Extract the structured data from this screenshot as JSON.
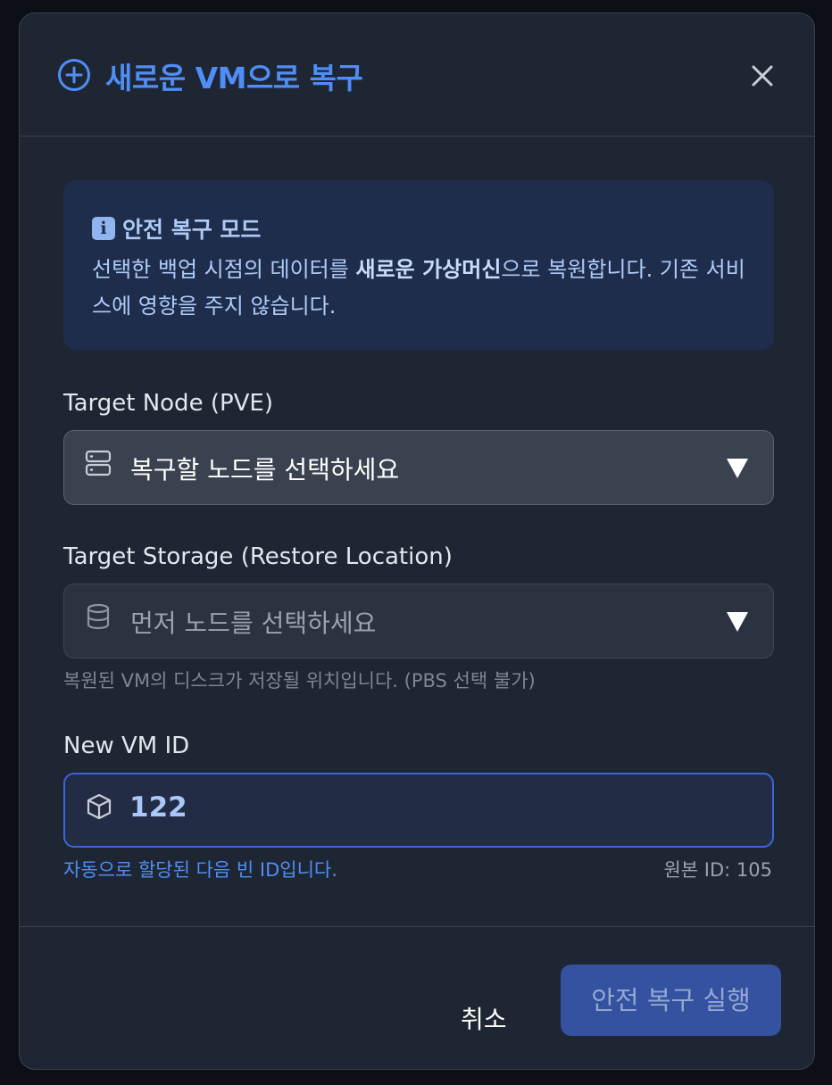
{
  "dialog": {
    "title": "새로운 VM으로 복구",
    "close_icon": "close-icon",
    "title_icon": "plus-circle-icon",
    "accent_color": "#4f8ef7"
  },
  "info": {
    "icon": "info-icon",
    "title": "안전 복구 모드",
    "body_before": "선택한 백업 시점의 데이터를 ",
    "body_bold": "새로운 가상머신",
    "body_after": "으로 복원합니다. 기존 서비스에 영향을 주지 않습니다."
  },
  "target_node": {
    "label": "Target Node (PVE)",
    "icon": "server-icon",
    "placeholder": "복구할 노드를 선택하세요"
  },
  "target_storage": {
    "label": "Target Storage (Restore Location)",
    "icon": "database-icon",
    "placeholder": "먼저 노드를 선택하세요",
    "hint": "복원된 VM의 디스크가 저장될 위치입니다. (PBS 선택 불가)"
  },
  "new_vm_id": {
    "label": "New VM ID",
    "icon": "cube-icon",
    "value": "122",
    "hint": "자동으로 할당된 다음 빈 ID입니다.",
    "original_id": "원본 ID: 105"
  },
  "footer": {
    "cancel_label": "취소",
    "submit_label": "안전 복구 실행"
  }
}
